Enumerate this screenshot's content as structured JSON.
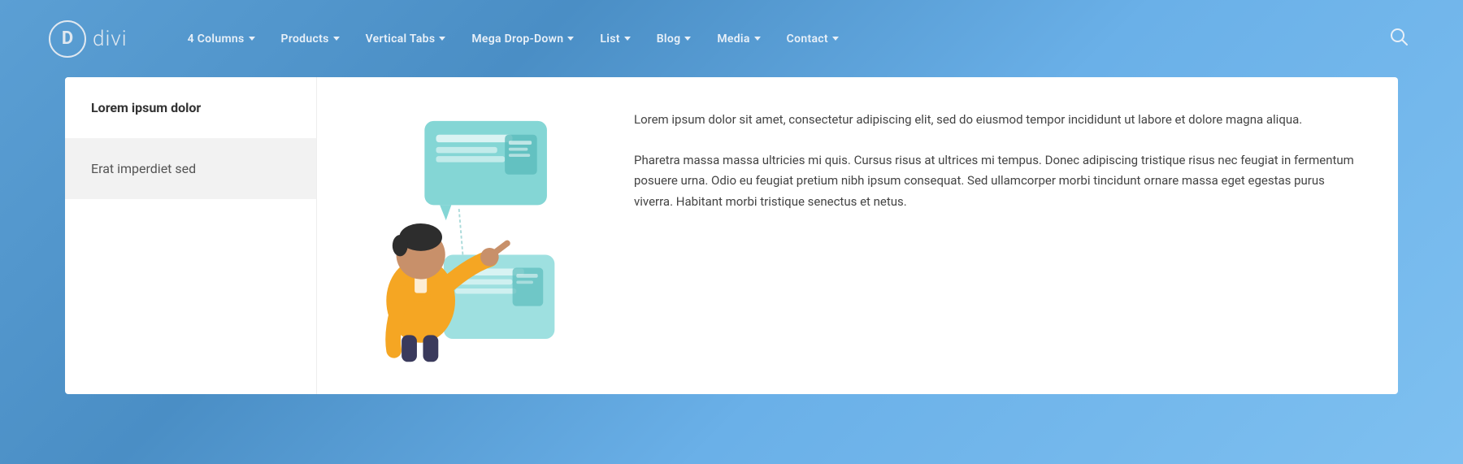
{
  "logo": {
    "letter": "D",
    "name": "divi"
  },
  "nav": {
    "items": [
      {
        "label": "4 Columns",
        "has_dropdown": true
      },
      {
        "label": "Products",
        "has_dropdown": true
      },
      {
        "label": "Vertical Tabs",
        "has_dropdown": true
      },
      {
        "label": "Mega Drop-Down",
        "has_dropdown": true
      },
      {
        "label": "List",
        "has_dropdown": true
      },
      {
        "label": "Blog",
        "has_dropdown": true
      },
      {
        "label": "Media",
        "has_dropdown": true
      },
      {
        "label": "Contact",
        "has_dropdown": true
      }
    ],
    "search_label": "search"
  },
  "card": {
    "sidebar_items": [
      {
        "label": "Lorem ipsum dolor",
        "state": "active"
      },
      {
        "label": "Erat imperdiet sed",
        "state": "secondary"
      }
    ],
    "paragraphs": [
      "Lorem ipsum dolor sit amet, consectetur adipiscing elit, sed do eiusmod tempor incididunt ut labore et dolore magna aliqua.",
      "Pharetra massa massa ultricies mi quis. Cursus risus at ultrices mi tempus. Donec adipiscing tristique risus nec feugiat in fermentum posuere urna. Odio eu feugiat pretium nibh ipsum consequat. Sed ullamcorper morbi tincidunt ornare massa eget egestas purus viverra. Habitant morbi tristique senectus et netus."
    ]
  }
}
